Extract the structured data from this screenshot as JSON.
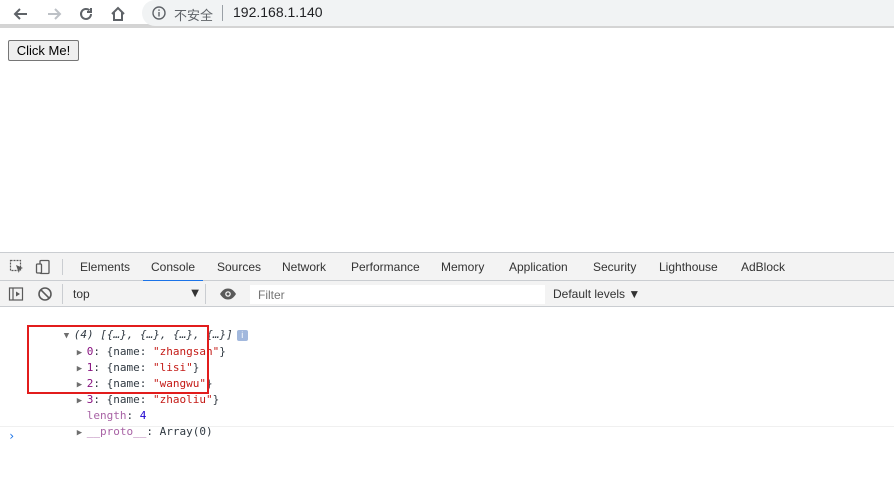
{
  "browser": {
    "security_label": "不安全",
    "url": "192.168.1.140"
  },
  "page": {
    "button_label": "Click Me!"
  },
  "devtools": {
    "tabs": [
      "Elements",
      "Console",
      "Sources",
      "Network",
      "Performance",
      "Memory",
      "Application",
      "Security",
      "Lighthouse",
      "AdBlock"
    ],
    "active_tab": "Console",
    "context": "top",
    "filter_placeholder": "Filter",
    "levels_label": "Default levels ▼"
  },
  "console": {
    "summary": "(4) [{…}, {…}, {…}, {…}]",
    "items": [
      {
        "index": "0",
        "value": "\"zhangsan\""
      },
      {
        "index": "1",
        "value": "\"lisi\""
      },
      {
        "index": "2",
        "value": "\"wangwu\""
      },
      {
        "index": "3",
        "value": "\"zhaoliu\""
      }
    ],
    "name_key": "name",
    "length_key": "length",
    "length_value": "4",
    "proto_key": "__proto__",
    "proto_value": "Array(0)"
  },
  "colors": {
    "accent": "#1a73e8",
    "highlight": "#e21c1c",
    "string": "#c41a16",
    "key": "#881280"
  }
}
